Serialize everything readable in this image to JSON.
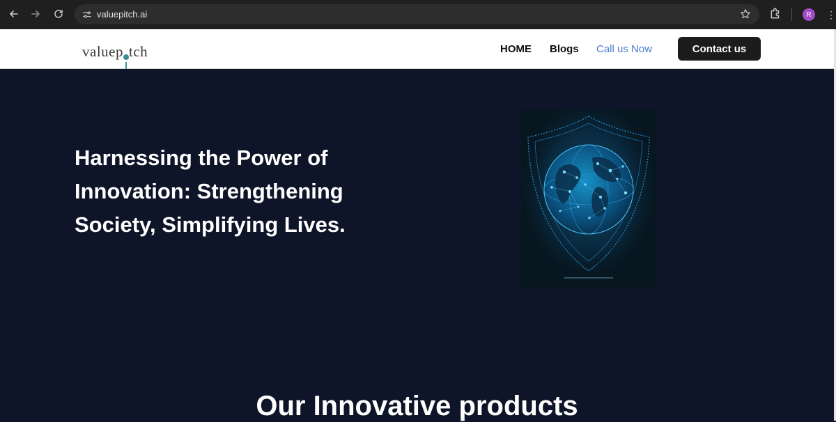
{
  "browser": {
    "url": "valuepitch.ai",
    "profile_initial": "R"
  },
  "site": {
    "logo_text_before": "valuep",
    "logo_text_after": "tch",
    "nav": {
      "home": "HOME",
      "blogs": "Blogs",
      "call": "Call us Now",
      "contact": "Contact us"
    }
  },
  "hero": {
    "title": "Harnessing the Power of Innovation: Strengthening Society, Simplifying Lives."
  },
  "products": {
    "heading": "Our Innovative products"
  },
  "colors": {
    "hero_bg": "#0f1529",
    "accent_link": "#4a7bd0",
    "button_bg": "#1c1c1c",
    "logo_accent": "#3a8f95"
  }
}
